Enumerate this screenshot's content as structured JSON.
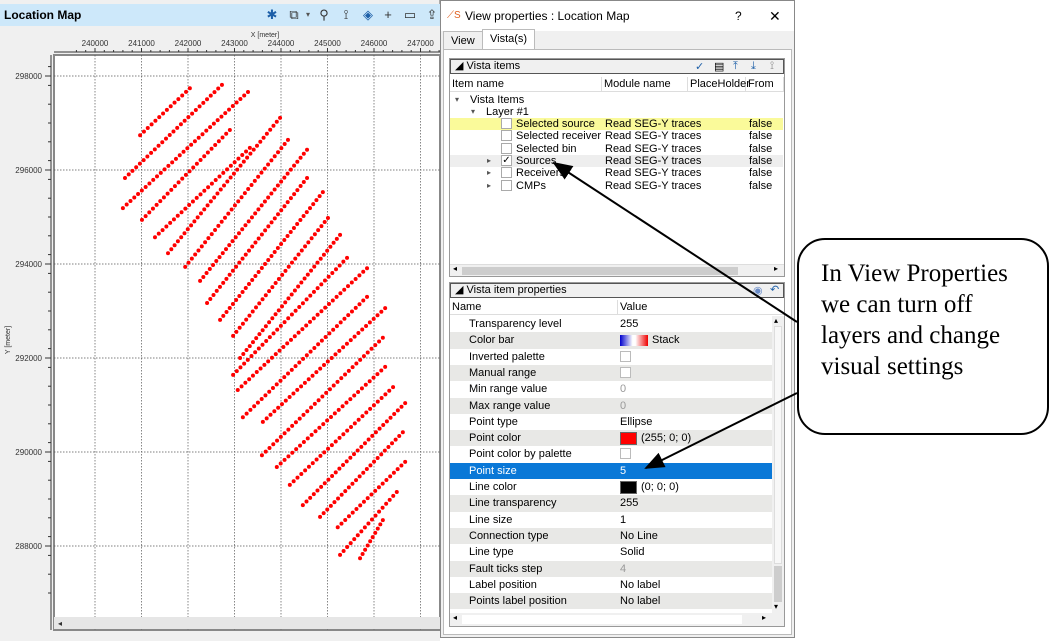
{
  "map": {
    "title": "Location Map",
    "toolbar_icons": [
      "gear-icon",
      "zoom-extent-icon",
      "dropdown-icon",
      "magnifier-icon",
      "pointer-icon",
      "layers-icon",
      "crosshair-icon",
      "comment-icon",
      "export-icon"
    ],
    "chart_data": {
      "type": "scatter",
      "xlabel": "X [meter]",
      "ylabel": "Y [meter]",
      "x_ticks": [
        240000,
        241000,
        242000,
        243000,
        244000,
        245000,
        246000,
        247000
      ],
      "y_ticks": [
        298000,
        296000,
        294000,
        292000,
        290000,
        288000
      ],
      "grid": true,
      "point_color": "#ff0000",
      "source_lines": [
        {
          "from": [
            240970,
            296740
          ],
          "to": [
            242040,
            297740
          ]
        },
        {
          "from": [
            240645,
            295830
          ],
          "to": [
            242730,
            297810
          ]
        },
        {
          "from": [
            240600,
            295190
          ],
          "to": [
            243290,
            297660
          ]
        },
        {
          "from": [
            241010,
            294940
          ],
          "to": [
            242900,
            296850
          ]
        },
        {
          "from": [
            241290,
            294570
          ],
          "to": [
            243330,
            296470
          ]
        },
        {
          "from": [
            241570,
            294230
          ],
          "to": [
            243980,
            297110
          ]
        },
        {
          "from": [
            241940,
            293940
          ],
          "to": [
            244150,
            296640
          ]
        },
        {
          "from": [
            242260,
            293640
          ],
          "to": [
            244560,
            296430
          ]
        },
        {
          "from": [
            242410,
            293170
          ],
          "to": [
            244560,
            295830
          ]
        },
        {
          "from": [
            242690,
            292810
          ],
          "to": [
            244900,
            295530
          ]
        },
        {
          "from": [
            242970,
            292470
          ],
          "to": [
            245010,
            294980
          ]
        },
        {
          "from": [
            243120,
            292000
          ],
          "to": [
            245270,
            294620
          ]
        },
        {
          "from": [
            242970,
            291640
          ],
          "to": [
            245420,
            294130
          ]
        },
        {
          "from": [
            243070,
            291320
          ],
          "to": [
            245850,
            293910
          ]
        },
        {
          "from": [
            243180,
            290740
          ],
          "to": [
            245850,
            293300
          ]
        },
        {
          "from": [
            243610,
            290640
          ],
          "to": [
            246240,
            293060
          ]
        },
        {
          "from": [
            243590,
            289930
          ],
          "to": [
            246190,
            292430
          ]
        },
        {
          "from": [
            243910,
            289680
          ],
          "to": [
            246240,
            291810
          ]
        },
        {
          "from": [
            244190,
            289300
          ],
          "to": [
            246410,
            291380
          ]
        },
        {
          "from": [
            244470,
            288870
          ],
          "to": [
            246670,
            291040
          ]
        },
        {
          "from": [
            244840,
            288620
          ],
          "to": [
            246620,
            290420
          ]
        },
        {
          "from": [
            245220,
            288400
          ],
          "to": [
            246670,
            289790
          ]
        },
        {
          "from": [
            245270,
            287810
          ],
          "to": [
            246490,
            289150
          ]
        },
        {
          "from": [
            245700,
            287740
          ],
          "to": [
            246190,
            288550
          ]
        }
      ]
    }
  },
  "dialog": {
    "title": "View properties : Location Map",
    "help": "?",
    "close": "✕",
    "tabs": [
      "View",
      "Vista(s)"
    ],
    "active_tab": "Vista(s)",
    "vista_items": {
      "header": "Vista items",
      "columns": [
        "Item name",
        "Module name",
        "PlaceHolder",
        "From DB"
      ],
      "root": "Vista Items",
      "layer": "Layer  #1",
      "rows": [
        {
          "name": "Selected source",
          "module": "Read SEG-Y traces",
          "from_db": "false",
          "checked": false,
          "highlight": true,
          "expandable": false
        },
        {
          "name": "Selected receiver",
          "module": "Read SEG-Y traces",
          "from_db": "false",
          "checked": false,
          "expandable": false
        },
        {
          "name": "Selected bin",
          "module": "Read SEG-Y traces",
          "from_db": "false",
          "checked": false,
          "expandable": false
        },
        {
          "name": "Sources",
          "module": "Read SEG-Y traces",
          "from_db": "false",
          "checked": true,
          "selected": true,
          "expandable": true
        },
        {
          "name": "Receivers",
          "module": "Read SEG-Y traces",
          "from_db": "false",
          "checked": false,
          "expandable": true
        },
        {
          "name": "CMPs",
          "module": "Read SEG-Y traces",
          "from_db": "false",
          "checked": false,
          "expandable": true
        }
      ]
    },
    "properties": {
      "header": "Vista item properties",
      "columns": [
        "Name",
        "Value"
      ],
      "rows": [
        {
          "name": "Transparency level",
          "value": "255"
        },
        {
          "name": "Color bar",
          "value": "Stack",
          "type": "colorbar"
        },
        {
          "name": "Inverted palette",
          "type": "checkbox"
        },
        {
          "name": "Manual range",
          "type": "checkbox"
        },
        {
          "name": "Min range value",
          "value": "0",
          "disabled": true
        },
        {
          "name": "Max range value",
          "value": "0",
          "disabled": true
        },
        {
          "name": "Point type",
          "value": "Ellipse"
        },
        {
          "name": "Point color",
          "value": "(255; 0; 0)",
          "type": "color",
          "color": "#ff0000"
        },
        {
          "name": "Point color by palette",
          "type": "checkbox"
        },
        {
          "name": "Point size",
          "value": "5",
          "selected": true
        },
        {
          "name": "Line color",
          "value": "(0; 0; 0)",
          "type": "color",
          "color": "#000000"
        },
        {
          "name": "Line transparency",
          "value": "255"
        },
        {
          "name": "Line size",
          "value": "1"
        },
        {
          "name": "Connection type",
          "value": "No Line"
        },
        {
          "name": "Line type",
          "value": "Solid"
        },
        {
          "name": "Fault ticks step",
          "value": "4",
          "disabled": true
        },
        {
          "name": "Label position",
          "value": "No label"
        },
        {
          "name": "Points label position",
          "value": "No label"
        }
      ]
    }
  },
  "callout": {
    "text": "In View Properties we can turn off layers and change visual settings"
  }
}
